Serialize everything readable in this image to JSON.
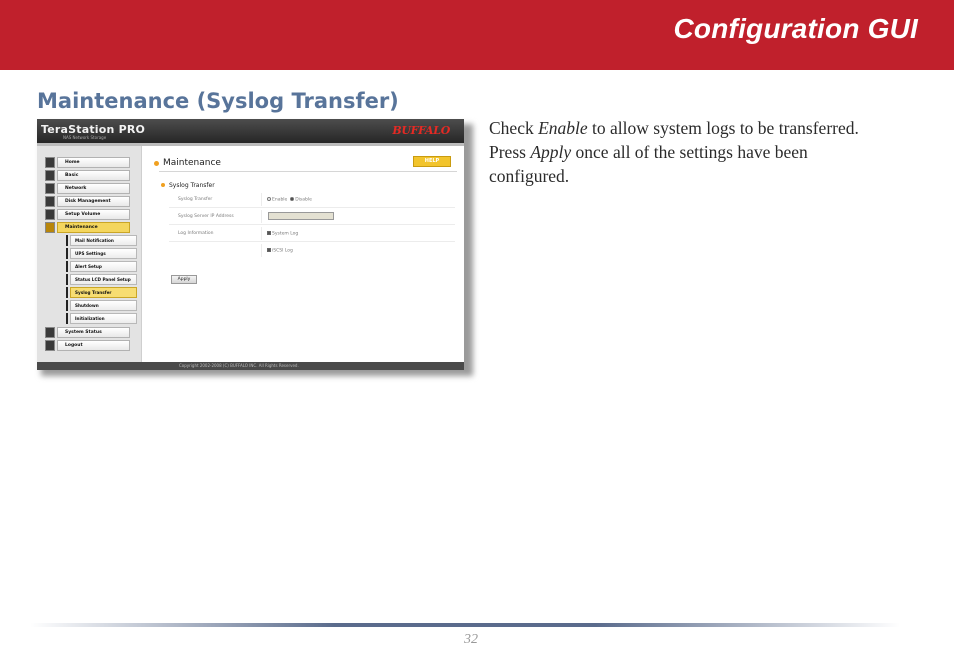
{
  "header": {
    "title": "Configuration GUI",
    "color": "#c0202c"
  },
  "section": {
    "title": "Maintenance (Syslog Transfer)"
  },
  "description": {
    "part1": "Check ",
    "em1": "Enable",
    "part2": " to allow system logs to be transferred.  Press ",
    "em2": "Apply",
    "part3": " once all of the settings have been configured."
  },
  "screenshot": {
    "product_logo": "TeraStation PRO",
    "product_subtitle": "NAS Network Storage",
    "brand_logo": "BUFFALO",
    "nav": [
      {
        "label": "Home",
        "icon": "home-icon"
      },
      {
        "label": "Basic",
        "icon": "basic-icon"
      },
      {
        "label": "Network",
        "icon": "network-icon"
      },
      {
        "label": "Disk Management",
        "icon": "disk-icon"
      },
      {
        "label": "Setup Volume",
        "icon": "volume-icon"
      },
      {
        "label": "Maintenance",
        "icon": "tools-icon",
        "selected": true
      }
    ],
    "subnav": [
      {
        "label": "Mail Notification"
      },
      {
        "label": "UPS Settings"
      },
      {
        "label": "Alert Setup"
      },
      {
        "label": "Status LCD Panel Setup"
      },
      {
        "label": "Syslog Transfer",
        "selected": true
      },
      {
        "label": "Shutdown"
      },
      {
        "label": "Initialization"
      }
    ],
    "nav_bottom": [
      {
        "label": "System Status",
        "icon": "status-icon"
      },
      {
        "label": "Logout",
        "icon": "logout-icon"
      }
    ],
    "main_title": "Maintenance",
    "help_label": "HELP",
    "section_title": "Syslog Transfer",
    "rows": {
      "syslog_transfer": {
        "label": "Syslog Transfer",
        "enable": "Enable",
        "disable": "Disable",
        "selected": "Disable"
      },
      "server_ip": {
        "label": "Syslog Server IP Address",
        "value": ""
      },
      "log_information": {
        "label": "Log Information",
        "option1": "System Log",
        "option2": "iSCSI Log"
      }
    },
    "apply_label": "Apply",
    "copyright": "Copyright 2002-2008 (C) BUFFALO INC. All Rights Reserved."
  },
  "footer": {
    "page_number": "32"
  }
}
